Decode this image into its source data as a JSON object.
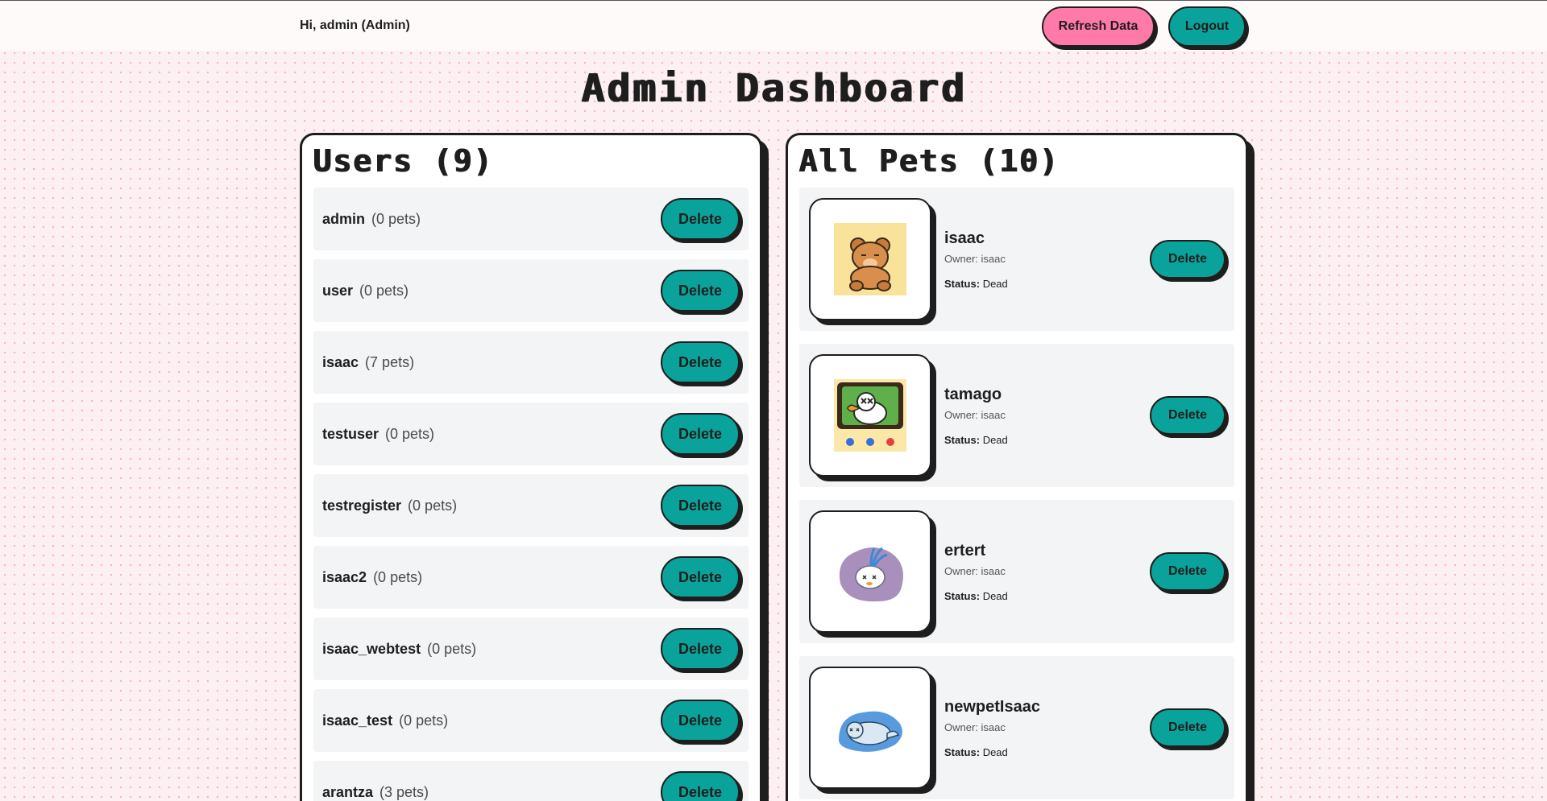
{
  "header": {
    "greeting": "Hi, admin (Admin)",
    "refresh_label": "Refresh Data",
    "logout_label": "Logout"
  },
  "page_title": "Admin Dashboard",
  "users_panel": {
    "title": "Users (9)",
    "delete_label": "Delete",
    "items": [
      {
        "name": "admin",
        "pets": "(0 pets)"
      },
      {
        "name": "user",
        "pets": "(0 pets)"
      },
      {
        "name": "isaac",
        "pets": "(7 pets)"
      },
      {
        "name": "testuser",
        "pets": "(0 pets)"
      },
      {
        "name": "testregister",
        "pets": "(0 pets)"
      },
      {
        "name": "isaac2",
        "pets": "(0 pets)"
      },
      {
        "name": "isaac_webtest",
        "pets": "(0 pets)"
      },
      {
        "name": "isaac_test",
        "pets": "(0 pets)"
      },
      {
        "name": "arantza",
        "pets": "(3 pets)"
      }
    ]
  },
  "pets_panel": {
    "title": "All Pets (10)",
    "delete_label": "Delete",
    "status_label": "Status:",
    "items": [
      {
        "name": "isaac",
        "owner": "Owner: isaac",
        "status": "Dead",
        "image": "sleeping-bear-icon",
        "bg": "#f9e29a"
      },
      {
        "name": "tamago",
        "owner": "Owner: isaac",
        "status": "Dead",
        "image": "duck-console-icon",
        "bg": "#fbe7a8"
      },
      {
        "name": "ertert",
        "owner": "Owner: isaac",
        "status": "Dead",
        "image": "ghost-bird-icon",
        "bg": "#ffffff"
      },
      {
        "name": "newpetIsaac",
        "owner": "Owner: isaac",
        "status": "Dead",
        "image": "seal-icon",
        "bg": "#ffffff"
      }
    ]
  },
  "colors": {
    "accent_teal": "#0aa39b",
    "accent_pink": "#ff7aa8",
    "outline": "#1e1e1e",
    "row_bg": "#f3f4f6"
  }
}
